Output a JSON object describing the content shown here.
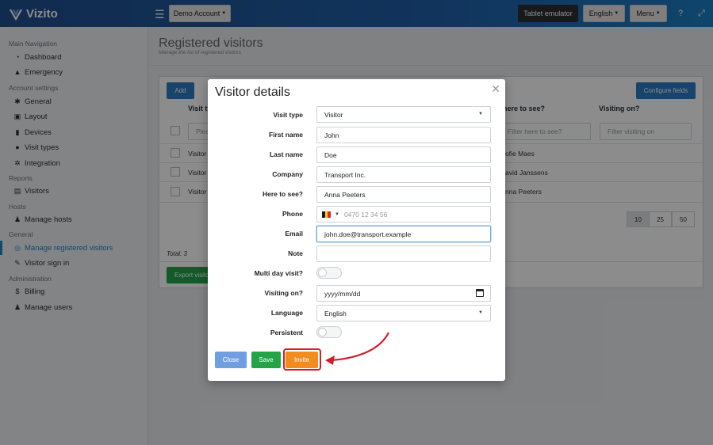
{
  "app": {
    "name": "Vizito"
  },
  "topbar": {
    "account_label": "Demo Account",
    "tablet_label": "Tablet emulator",
    "language_label": "English",
    "menu_label": "Menu"
  },
  "sidebar": {
    "sections": [
      "Main Navigation",
      "Account settings",
      "Reports",
      "Hosts",
      "General",
      "Administration"
    ],
    "items": [
      {
        "label": "Dashboard",
        "icon": "dashboard-icon"
      },
      {
        "label": "Emergency",
        "icon": "warning-icon"
      },
      {
        "label": "General",
        "icon": "gear-icon"
      },
      {
        "label": "Layout",
        "icon": "image-icon"
      },
      {
        "label": "Devices",
        "icon": "tablet-icon"
      },
      {
        "label": "Visit types",
        "icon": "users-icon"
      },
      {
        "label": "Integration",
        "icon": "cogs-icon"
      },
      {
        "label": "Visitors",
        "icon": "list-icon"
      },
      {
        "label": "Manage hosts",
        "icon": "male-icon"
      },
      {
        "label": "Manage registered visitors",
        "icon": "target-icon",
        "active": true
      },
      {
        "label": "Visitor sign in",
        "icon": "pencil-icon"
      },
      {
        "label": "Billing",
        "icon": "dollar-icon"
      },
      {
        "label": "Manage users",
        "icon": "user-plus-icon"
      }
    ]
  },
  "page": {
    "title": "Registered visitors",
    "subtitle": "Manage the list of registered visitors"
  },
  "table": {
    "add_label": "Add",
    "configure_label": "Configure fields",
    "headers": {
      "visit_type": "Visit ty",
      "host": "here to see?",
      "visiting_on": "Visiting on?"
    },
    "filters": {
      "name": "Plea",
      "host": "Filter here to see?",
      "visiting_on": "Filter visiting on"
    },
    "rows": [
      {
        "visit_type": "Visitor",
        "host": "ofie Maes"
      },
      {
        "visit_type": "Visitor",
        "host": "avid Janssens"
      },
      {
        "visit_type": "Visitor",
        "host": "nna Peeters"
      }
    ],
    "page_sizes": [
      "10",
      "25",
      "50"
    ],
    "total": "Total: 3",
    "export_label": "Export visito"
  },
  "modal": {
    "title": "Visitor details",
    "fields": {
      "visit_type": {
        "label": "Visit type",
        "value": "Visitor"
      },
      "first_name": {
        "label": "First name",
        "value": "John"
      },
      "last_name": {
        "label": "Last name",
        "value": "Doe"
      },
      "company": {
        "label": "Company",
        "value": "Transport Inc."
      },
      "host": {
        "label": "Here to see?",
        "value": "Anna Peeters"
      },
      "phone": {
        "label": "Phone",
        "placeholder": "0470 12 34 56",
        "flag_colors": [
          "#1a1a1a",
          "#f5d20a",
          "#e3262b"
        ]
      },
      "email": {
        "label": "Email",
        "value": "john.doe@transport.example"
      },
      "note": {
        "label": "Note",
        "value": ""
      },
      "multi_day": {
        "label": "Multi day visit?"
      },
      "visiting_on": {
        "label": "Visiting on?",
        "placeholder": "yyyy/mm/dd"
      },
      "language": {
        "label": "Language",
        "value": "English"
      },
      "persistent": {
        "label": "Persistent"
      }
    },
    "buttons": {
      "close": "Close",
      "save": "Save",
      "invite": "Invite"
    }
  },
  "colors": {
    "primary": "#2d7bc4",
    "success": "#22a447",
    "warning": "#f28c1e",
    "close_btn": "#6f9fe0",
    "highlight": "#d0202a"
  }
}
